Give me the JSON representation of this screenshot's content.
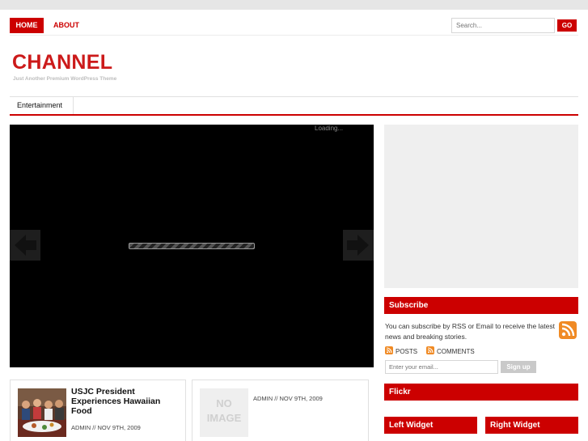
{
  "nav": {
    "home": "HOME",
    "about": "ABOUT"
  },
  "search": {
    "placeholder": "Search...",
    "go": "GO"
  },
  "site": {
    "title": "CHANNEL",
    "tagline": "Just Another Premium WordPress Theme"
  },
  "categories": [
    "Entertainment"
  ],
  "slider": {
    "loading": "Loading..."
  },
  "sidebar": {
    "subscribe": {
      "title": "Subscribe",
      "text": "You can subscribe by RSS or Email to receive the latest news and breaking stories.",
      "posts": "POSTS",
      "comments": "COMMENTS",
      "email_placeholder": "Enter your email...",
      "signup": "Sign up"
    },
    "flickr": "Flickr",
    "left_widget": "Left Widget",
    "right_widget": "Right Widget"
  },
  "posts": [
    {
      "title": "USJC President Experiences Hawaiian Food",
      "meta": "ADMIN // NOV 9TH, 2009"
    },
    {
      "no_image": "NO IMAGE",
      "meta": "ADMIN // NOV 9TH, 2009"
    }
  ],
  "colors": {
    "accent": "#cc0000",
    "sidebar_box": "#efefef"
  },
  "icons": [
    "rss-icon",
    "arrow-left-icon",
    "arrow-right-icon"
  ]
}
